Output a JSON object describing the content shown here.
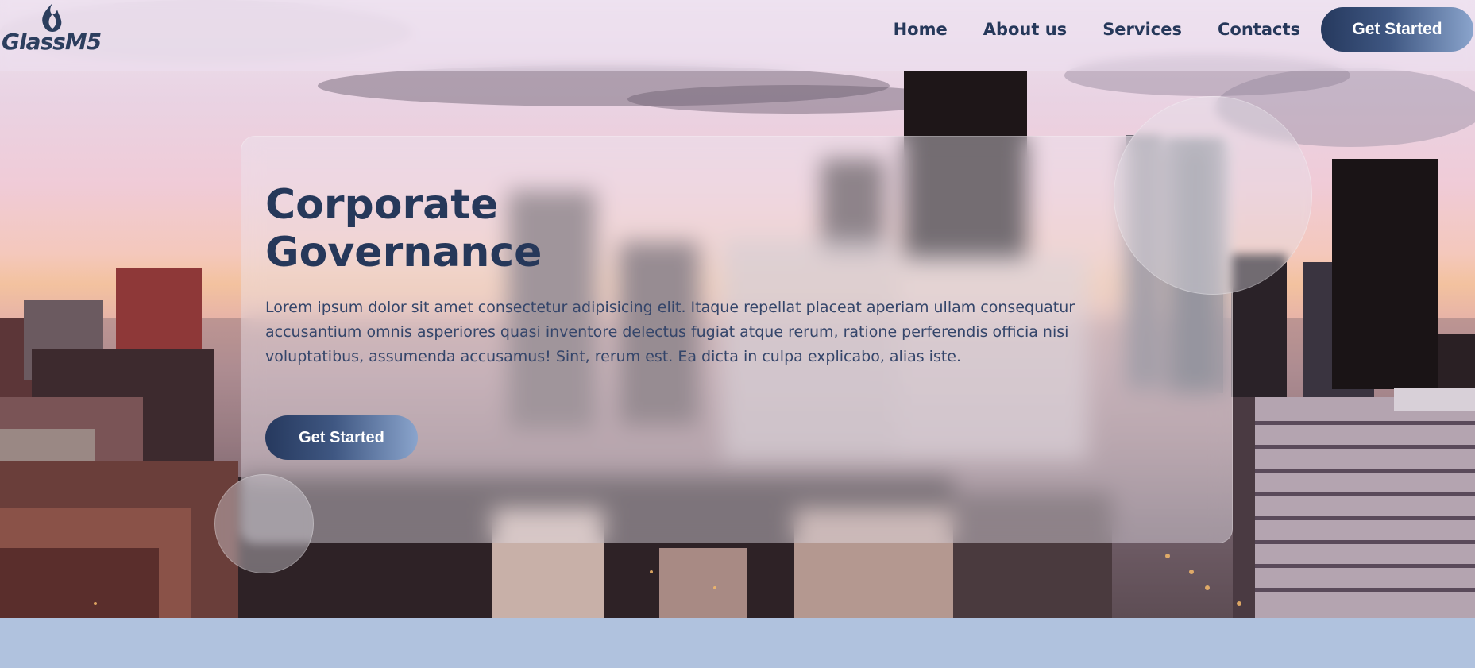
{
  "brand": {
    "name": "GlassM5",
    "logo_icon": "flame-icon"
  },
  "nav": {
    "links": [
      {
        "label": "Home"
      },
      {
        "label": "About us"
      },
      {
        "label": "Services"
      },
      {
        "label": "Contacts"
      }
    ],
    "cta_label": "Get Started"
  },
  "hero": {
    "title_line1": "Corporate",
    "title_line2": "Governance",
    "body": "Lorem ipsum dolor sit amet consectetur adipisicing elit. Itaque repellat placeat aperiam ullam consequatur accusantium omnis asperiores quasi inventore delectus fugiat atque rerum, ratione perferendis officia nisi voluptatibus, assumenda accusamus! Sint, rerum est. Ea dicta in culpa explicabo, alias iste.",
    "cta_label": "Get Started",
    "background": "city-skyline-photo"
  },
  "colors": {
    "primary": "#26385a",
    "button_gradient_start": "#26395e",
    "button_gradient_end": "#8aa4cc",
    "footer_strip": "#b0c2de"
  }
}
